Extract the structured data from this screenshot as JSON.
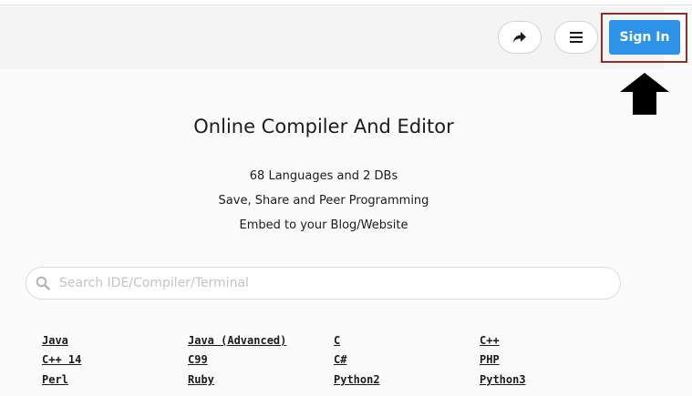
{
  "header": {
    "share_icon": "share-arrow-icon",
    "menu_icon": "hamburger-menu-icon",
    "signin_label": "Sign In"
  },
  "annotation": {
    "arrow_icon": "up-arrow-icon",
    "highlight_color": "#8f2d27"
  },
  "hero": {
    "title": "Online Compiler And Editor",
    "line1": "68 Languages and 2 DBs",
    "line2": "Save, Share and Peer Programming",
    "line3": "Embed to your Blog/Website"
  },
  "search": {
    "placeholder": "Search IDE/Compiler/Terminal",
    "value": ""
  },
  "languages": [
    [
      "Java",
      "Java (Advanced)",
      "C",
      "C++"
    ],
    [
      "C++ 14",
      "C99",
      "C#",
      "PHP"
    ],
    [
      "Perl",
      "Ruby",
      "Python2",
      "Python3"
    ]
  ],
  "colors": {
    "accent": "#2c93e8",
    "header_bg": "#f4f4f4"
  }
}
